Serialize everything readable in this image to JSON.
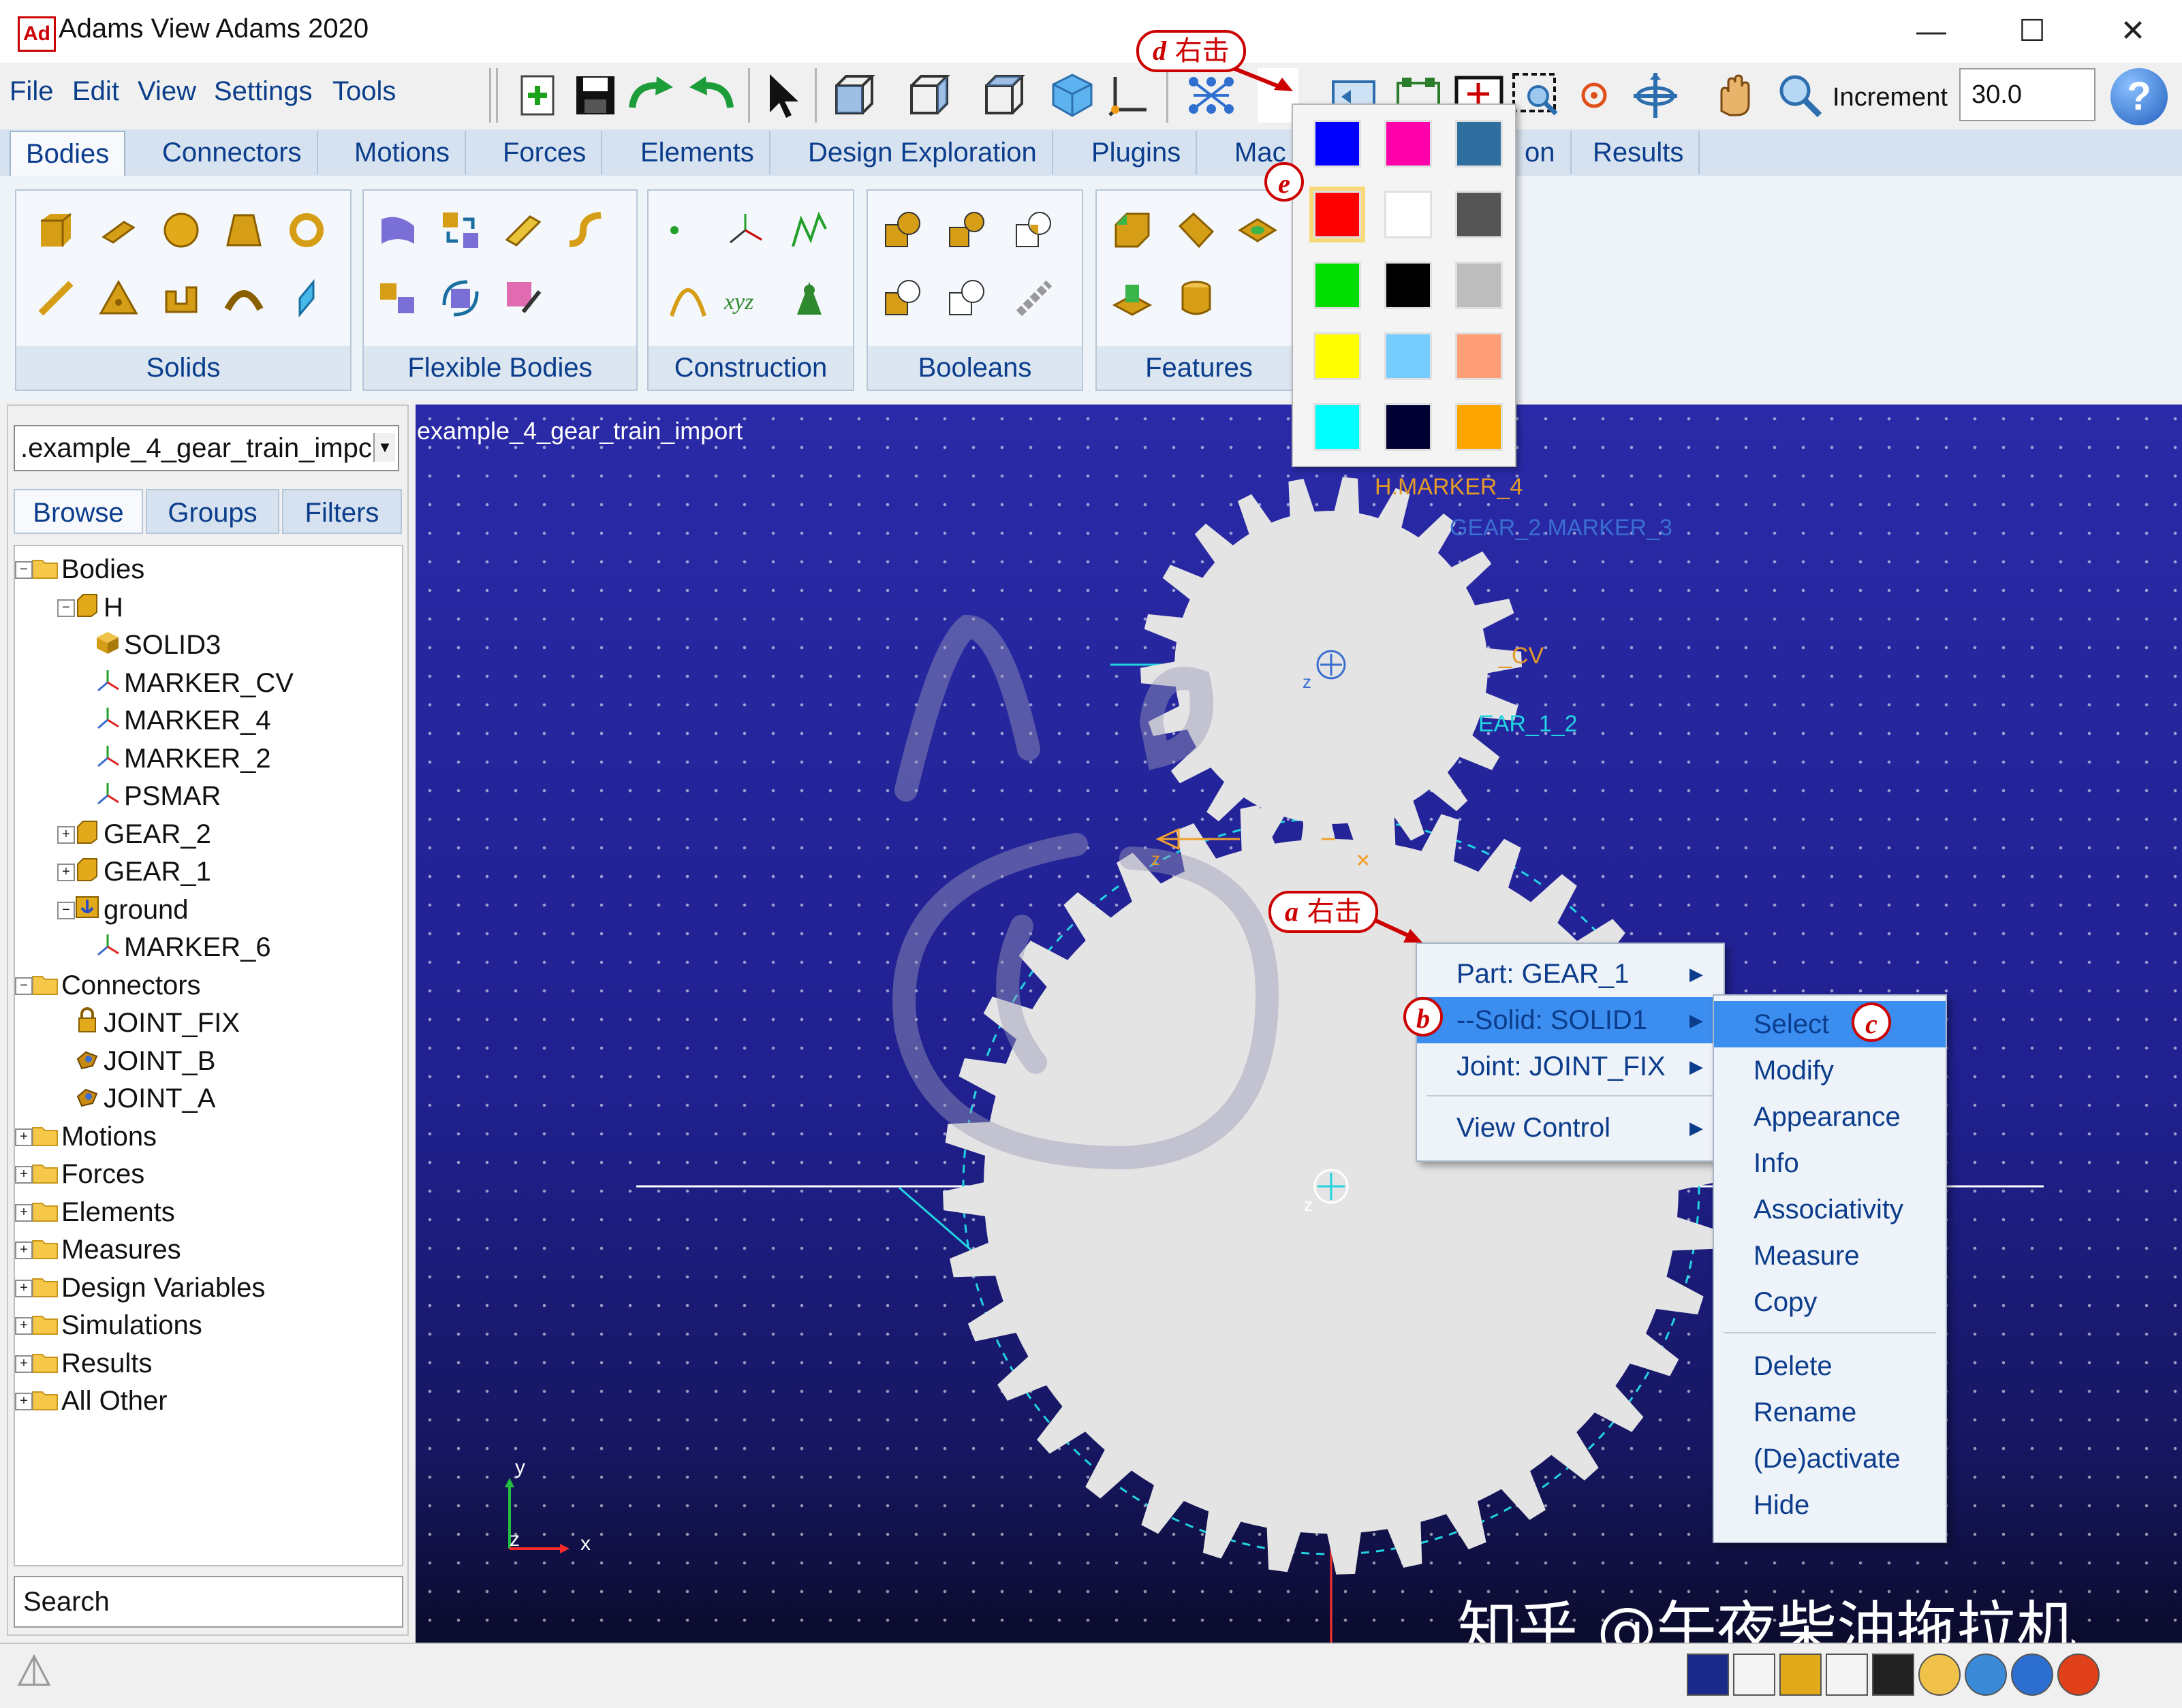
{
  "window": {
    "title": "Adams View Adams 2020",
    "logo": "Ad",
    "controls": {
      "minimize": "—",
      "maximize": "☐",
      "close": "✕"
    }
  },
  "menu": [
    "File",
    "Edit",
    "View",
    "Settings",
    "Tools"
  ],
  "toolbar": {
    "icons": [
      "new-model-icon",
      "save-icon",
      "redo-icon",
      "undo-icon",
      "select-arrow-icon",
      "front-view-icon",
      "side-view-icon",
      "top-view-icon",
      "iso-view-icon",
      "coordinate-icon",
      "render-mode-icon",
      "color-picker-icon",
      "icon-display-icon",
      "layout-icon",
      "fit-view-icon",
      "zoom-box-icon",
      "center-icon",
      "rotate-icon",
      "pan-icon",
      "zoom-icon"
    ],
    "increment_label": "Increment",
    "increment_value": "30.0",
    "help_label": "?"
  },
  "tabs": [
    "Bodies",
    "Connectors",
    "Motions",
    "Forces",
    "Elements",
    "Design Exploration",
    "Plugins",
    "Mac",
    "on",
    "Results"
  ],
  "ribbon": {
    "groups": [
      {
        "label": "Solids",
        "icons": [
          "box-icon",
          "cylinder-icon",
          "sphere-icon",
          "frustum-icon",
          "torus-icon",
          "link-icon",
          "plate-icon",
          "extrusion-icon",
          "revolution-icon",
          "plane-icon"
        ]
      },
      {
        "label": "Flexible Bodies",
        "icons": [
          "flex-body-icon",
          "flex-swap-icon",
          "viewflex-icon",
          "flex-beam-icon",
          "flex-mnf-icon",
          "flex-convert-icon",
          "flex-color-icon"
        ]
      },
      {
        "label": "Construction",
        "icons": [
          "point-icon",
          "marker-icon",
          "polyline-icon",
          "arc-icon",
          "spline-icon",
          "construction-frame-icon"
        ]
      },
      {
        "label": "Booleans",
        "icons": [
          "bool-union-icon",
          "bool-merge-icon",
          "bool-intersect-icon",
          "bool-cut-icon",
          "bool-split-icon",
          "bool-chain-icon"
        ]
      },
      {
        "label": "Features",
        "icons": [
          "chamfer-icon",
          "fillet-icon",
          "hole-icon",
          "boss-icon",
          "shell-icon"
        ]
      }
    ]
  },
  "palette": {
    "colors": [
      "#0000ff",
      "#ff00aa",
      "#2e6fa0",
      "#ff0000",
      "#ffffff",
      "#555555",
      "#00dd00",
      "#000000",
      "#bdbdbd",
      "#ffff00",
      "#77ccff",
      "#ff9f77",
      "#00ffff",
      "#000033",
      "#ffa500"
    ]
  },
  "left_panel": {
    "model_select": ".example_4_gear_train_impc",
    "tabs": [
      "Browse",
      "Groups",
      "Filters"
    ],
    "tree": [
      {
        "label": "Bodies",
        "icon": "folder-icon",
        "level": 0,
        "expander": "−"
      },
      {
        "label": "H",
        "icon": "part-icon",
        "level": 1,
        "expander": "−"
      },
      {
        "label": "SOLID3",
        "icon": "solid-icon",
        "level": 2,
        "expander": ""
      },
      {
        "label": "MARKER_CV",
        "icon": "marker-icon",
        "level": 2,
        "expander": ""
      },
      {
        "label": "MARKER_4",
        "icon": "marker-icon",
        "level": 2,
        "expander": ""
      },
      {
        "label": "MARKER_2",
        "icon": "marker-icon",
        "level": 2,
        "expander": ""
      },
      {
        "label": "PSMAR",
        "icon": "marker-icon",
        "level": 2,
        "expander": ""
      },
      {
        "label": "GEAR_2",
        "icon": "part-icon",
        "level": 1,
        "expander": "+"
      },
      {
        "label": "GEAR_1",
        "icon": "part-icon",
        "level": 1,
        "expander": "+"
      },
      {
        "label": "ground",
        "icon": "ground-icon",
        "level": 1,
        "expander": "−"
      },
      {
        "label": "MARKER_6",
        "icon": "marker-icon",
        "level": 2,
        "expander": ""
      },
      {
        "label": "Connectors",
        "icon": "folder-icon",
        "level": 0,
        "expander": "−"
      },
      {
        "label": "JOINT_FIX",
        "icon": "lock-icon",
        "level": 1,
        "expander": ""
      },
      {
        "label": "JOINT_B",
        "icon": "joint-icon",
        "level": 1,
        "expander": ""
      },
      {
        "label": "JOINT_A",
        "icon": "joint-icon",
        "level": 1,
        "expander": ""
      },
      {
        "label": "Motions",
        "icon": "folder-icon",
        "level": 0,
        "expander": "+"
      },
      {
        "label": "Forces",
        "icon": "folder-icon",
        "level": 0,
        "expander": "+"
      },
      {
        "label": "Elements",
        "icon": "folder-icon",
        "level": 0,
        "expander": "+"
      },
      {
        "label": "Measures",
        "icon": "folder-icon",
        "level": 0,
        "expander": "+"
      },
      {
        "label": "Design Variables",
        "icon": "folder-icon",
        "level": 0,
        "expander": "+"
      },
      {
        "label": "Simulations",
        "icon": "folder-icon",
        "level": 0,
        "expander": "+"
      },
      {
        "label": "Results",
        "icon": "folder-icon",
        "level": 0,
        "expander": "+"
      },
      {
        "label": "All Other",
        "icon": "folder-icon",
        "level": 0,
        "expander": "+"
      }
    ],
    "search_placeholder": "Search"
  },
  "viewport": {
    "title": "example_4_gear_train_import",
    "labels": {
      "h_marker_4": "H.MARKER_4",
      "gear2_marker": "GEAR_2.MARKER_3",
      "cv": "_CV",
      "gear_1_2": "EAR_1_2",
      "z1": "z",
      "z2": "z",
      "z3": "z",
      "x_small": "x"
    },
    "triad": {
      "y": "y",
      "z": "z",
      "x": "x"
    }
  },
  "context_menu": {
    "items": [
      {
        "label": "Part: GEAR_1",
        "arrow": "▶"
      },
      {
        "label": "--Solid: SOLID1",
        "arrow": "▶"
      },
      {
        "label": "Joint: JOINT_FIX",
        "arrow": "▶"
      },
      {
        "label": "View Control",
        "arrow": "▶"
      }
    ]
  },
  "submenu": {
    "items": [
      "Select",
      "Modify",
      "Appearance",
      "Info",
      "Associativity",
      "Measure",
      "Copy",
      "Delete",
      "Rename",
      "(De)activate",
      "Hide"
    ]
  },
  "annotations": {
    "a": {
      "letter": "a",
      "text": "右击"
    },
    "b": {
      "letter": "b"
    },
    "c": {
      "letter": "c"
    },
    "d": {
      "letter": "d",
      "text": "右击"
    },
    "e": {
      "letter": "e"
    }
  },
  "watermark": "知乎 @午夜柴油拖拉机",
  "status_icons": [
    "cube-display-icon",
    "plot-icon",
    "color-box-icon",
    "table-icon",
    "cube-black-icon",
    "sphere-info-icon",
    "tree-icon",
    "info-icon",
    "stop-icon"
  ],
  "colors": {
    "accent": "#3b8ef0",
    "callout": "#cc0000",
    "viewport": "#24249c",
    "gear": "#e4e4e4"
  }
}
